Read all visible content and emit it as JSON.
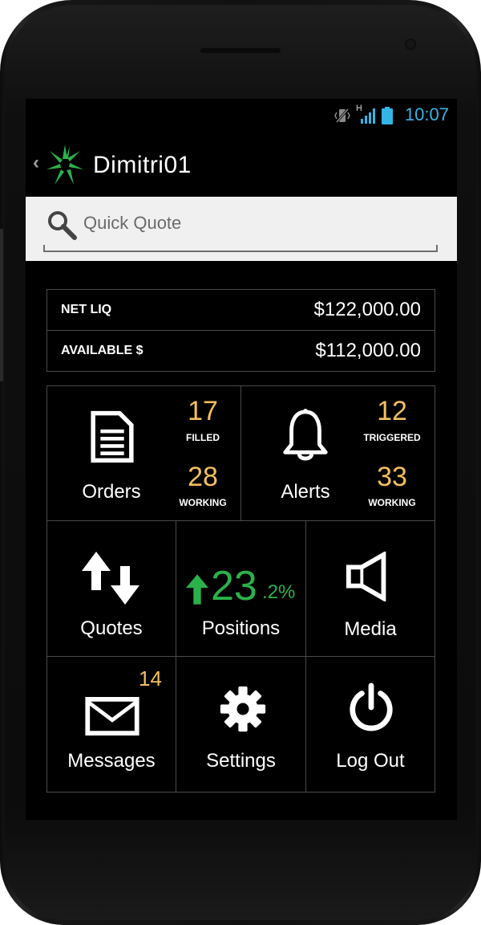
{
  "status_bar": {
    "time": "10:07",
    "network_type": "H",
    "icons": [
      "vibrate-icon",
      "signal-icon",
      "battery-icon"
    ]
  },
  "header": {
    "title": "Dimitri01",
    "back_icon": "chevron-left-icon",
    "logo_icon": "starburst-logo",
    "brand_color": "#2ab24a"
  },
  "search": {
    "placeholder": "Quick Quote",
    "value": ""
  },
  "account": {
    "rows": [
      {
        "label": "NET LIQ",
        "value": "$122,000.00"
      },
      {
        "label": "AVAILABLE $",
        "value": "$112,000.00"
      }
    ]
  },
  "tiles": {
    "orders": {
      "label": "Orders",
      "icon": "document-icon",
      "filled_count": "17",
      "filled_label": "FILLED",
      "working_count": "28",
      "working_label": "WORKING"
    },
    "alerts": {
      "label": "Alerts",
      "icon": "bell-icon",
      "triggered_count": "12",
      "triggered_label": "TRIGGERED",
      "working_count": "33",
      "working_label": "WORKING"
    },
    "quotes": {
      "label": "Quotes",
      "icon": "up-down-arrows-icon"
    },
    "positions": {
      "label": "Positions",
      "icon": "up-arrow-icon",
      "change_whole": "23",
      "change_fraction": ".2%",
      "change_color": "#2ab24a"
    },
    "media": {
      "label": "Media",
      "icon": "speaker-icon"
    },
    "messages": {
      "label": "Messages",
      "icon": "envelope-icon",
      "badge": "14"
    },
    "settings": {
      "label": "Settings",
      "icon": "gear-icon"
    },
    "logout": {
      "label": "Log Out",
      "icon": "power-icon"
    }
  },
  "colors": {
    "accent_count": "#f3bf5f",
    "positive": "#2ab24a",
    "clock": "#33b5e5"
  }
}
